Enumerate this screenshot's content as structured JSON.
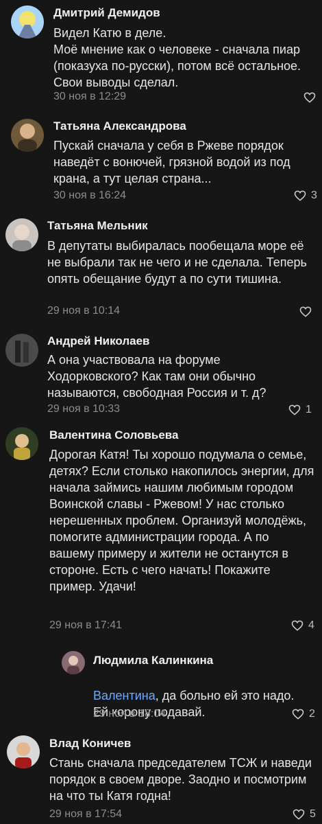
{
  "comments": [
    {
      "author": "Дмитрий Демидов",
      "text": "Видел Катю в деле.\nМоё мнение как о человеке - сначала пиар (показуха по-русски), потом всё остальное. Свои выводы сделал.",
      "time": "30 ноя в 12:29",
      "likes": ""
    },
    {
      "author": "Татьяна Александрова",
      "text": "Пускай сначала у себя в Ржеве порядок наведёт с вонючей, грязной водой из под крана, а тут целая страна...",
      "time": "30 ноя в 16:24",
      "likes": "3"
    },
    {
      "author": "Татьяна Мельник",
      "text": "В депутаты выбиралась пообещала море её не выбрали так не чего и не сделала. Теперь опять обещание будут а по сути тишина.",
      "time": "29 ноя в 10:14",
      "likes": ""
    },
    {
      "author": "Андрей Николаев",
      "text": "А она участвовала на форуме Ходорковского? Как там они обычно называются, свободная Россия и т. д?",
      "time": "29 ноя в 10:33",
      "likes": "1"
    },
    {
      "author": "Валентина Соловьева",
      "text": "Дорогая Катя! Ты хорошо подумала о семье, детях? Если столько накопилось энергии, для начала займись нашим любимым городом Воинской славы - Ржевом! У нас столько нерешенных проблем. Организуй молодёжь, помогите администрации города. А по вашему примеру и жители не останутся в стороне. Есть с чего начать! Покажите пример. Удачи!",
      "time": "29 ноя в 17:41",
      "likes": "4"
    },
    {
      "author": "Людмила Калинкина",
      "mention": "Валентина",
      "text": ", да больно ей это надо. Ей корону подавай.",
      "time": "29 ноя в 18:04",
      "likes": "2"
    },
    {
      "author": "Влад Коничев",
      "text": "Стань сначала председателем ТСЖ и наведи порядок в своем дворе. Заодно и посмотрим на что ты Катя годна!",
      "time": "29 ноя в 17:54",
      "likes": "5"
    }
  ]
}
